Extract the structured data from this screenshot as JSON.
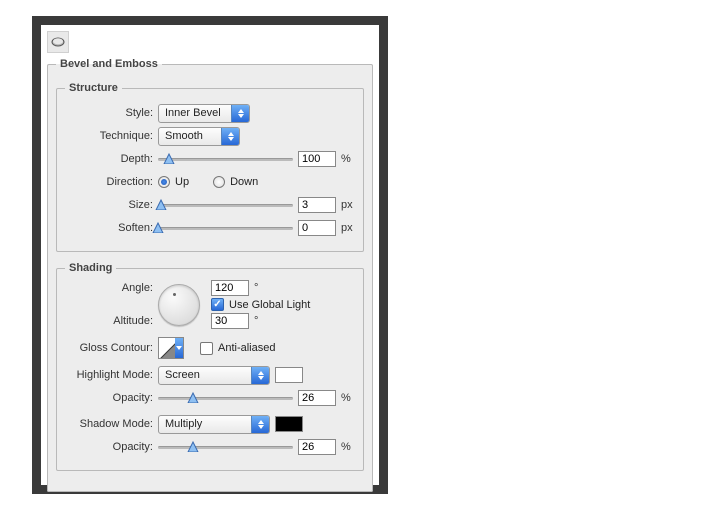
{
  "panel": {
    "title": "Bevel and Emboss",
    "structure": {
      "title": "Structure",
      "style_label": "Style:",
      "style_value": "Inner Bevel",
      "technique_label": "Technique:",
      "technique_value": "Smooth",
      "depth_label": "Depth:",
      "depth_value": "100",
      "depth_unit": "%",
      "direction_label": "Direction:",
      "direction_up_label": "Up",
      "direction_down_label": "Down",
      "direction_value": "up",
      "size_label": "Size:",
      "size_value": "3",
      "size_unit": "px",
      "soften_label": "Soften:",
      "soften_value": "0",
      "soften_unit": "px"
    },
    "shading": {
      "title": "Shading",
      "angle_label": "Angle:",
      "angle_value": "120",
      "angle_unit": "°",
      "use_global_light_label": "Use Global Light",
      "use_global_light": true,
      "altitude_label": "Altitude:",
      "altitude_value": "30",
      "altitude_unit": "°",
      "gloss_contour_label": "Gloss Contour:",
      "anti_aliased_label": "Anti-aliased",
      "anti_aliased": false,
      "highlight_mode_label": "Highlight Mode:",
      "highlight_mode_value": "Screen",
      "highlight_color": "#ffffff",
      "highlight_opacity_label": "Opacity:",
      "highlight_opacity_value": "26",
      "highlight_opacity_unit": "%",
      "shadow_mode_label": "Shadow Mode:",
      "shadow_mode_value": "Multiply",
      "shadow_color": "#000000",
      "shadow_opacity_label": "Opacity:",
      "shadow_opacity_value": "26",
      "shadow_opacity_unit": "%"
    }
  }
}
